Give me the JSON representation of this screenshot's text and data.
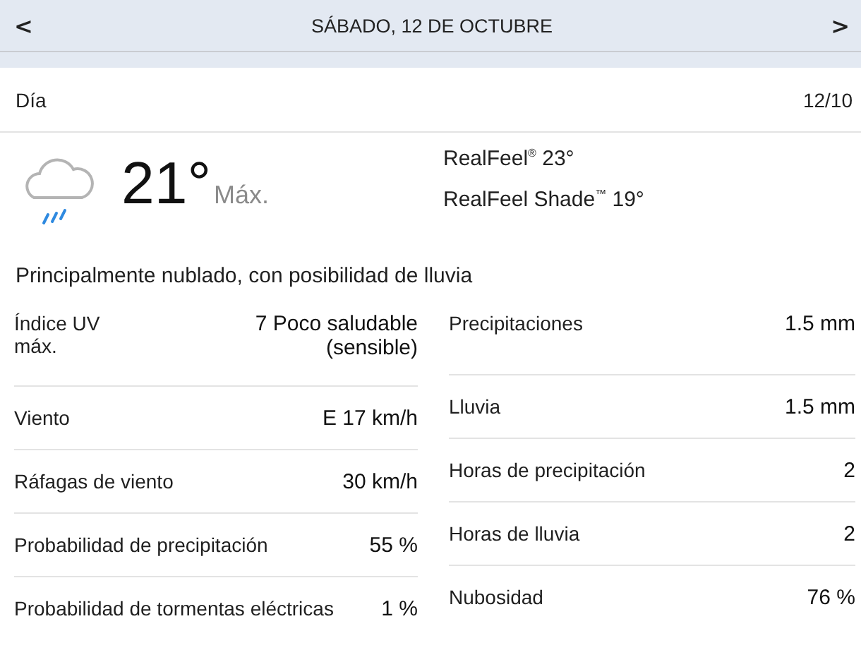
{
  "header": {
    "prev": "<",
    "title": "SÁBADO, 12 DE OCTUBRE",
    "next": ">"
  },
  "day": {
    "label": "Día",
    "date": "12/10"
  },
  "current": {
    "temperature": "21°",
    "temp_label": "Máx.",
    "realfeel": "RealFeel$^{®}$ 23°",
    "realfeel_shade": "RealFeel Shade$^{™}$ 19°"
  },
  "description": "Principalmente nublado, con posibilidad de lluvia",
  "details_left": [
    {
      "label": "Índice UV máx.",
      "value": "7 Poco saludable (sensible)"
    },
    {
      "label": "Viento",
      "value": "E 17 km/h"
    },
    {
      "label": "Ráfagas de viento",
      "value": "30 km/h"
    },
    {
      "label": "Probabilidad de precipitación",
      "value": "55 %"
    },
    {
      "label": "Probabilidad de tormentas eléctricas",
      "value": "1 %"
    }
  ],
  "details_right": [
    {
      "label": "Precipitaciones",
      "value": "1.5 mm"
    },
    {
      "label": "Lluvia",
      "value": "1.5 mm"
    },
    {
      "label": "Horas de precipitación",
      "value": "2"
    },
    {
      "label": "Horas de lluvia",
      "value": "2"
    },
    {
      "label": "Nubosidad",
      "value": "76 %"
    }
  ]
}
